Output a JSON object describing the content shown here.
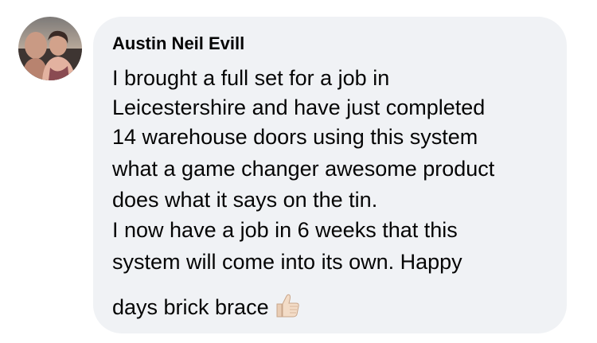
{
  "comment": {
    "author": "Austin Neil Evill",
    "lines": [
      "I brought a full set for a job in",
      "Leicestershire and have just completed",
      "14 warehouse doors using this system",
      "what a game changer awesome product",
      "does what it says on the tin.",
      "I now have a job in 6 weeks that this",
      "system will come into its own. Happy",
      "days brick brace"
    ],
    "emoji": "thumbs-up-icon"
  },
  "colors": {
    "bubble_background": "#f0f2f5",
    "text": "#050505"
  }
}
